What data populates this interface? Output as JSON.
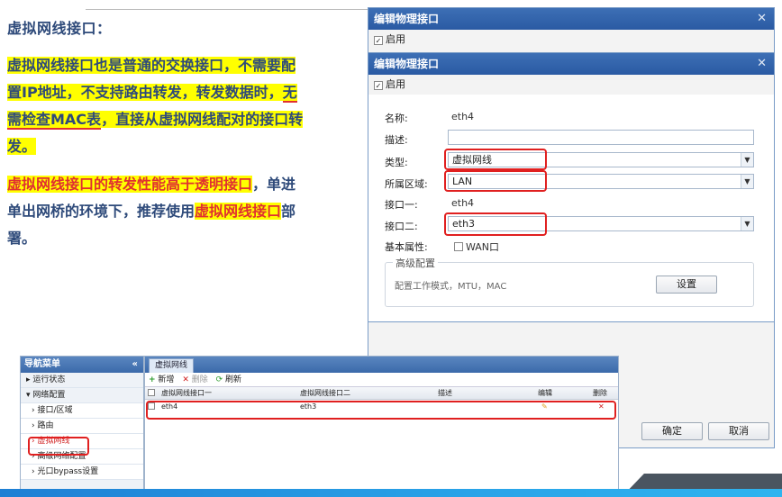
{
  "left_text": {
    "heading": "虚拟网线接口：",
    "p1_a": "虚拟网线接口",
    "p1_b": "也是普通的交换接口，不需要配置IP地址，不支持路由转发，转发数据时，",
    "p1_c": "无需检查MAC表",
    "p1_d": "，直接从虚拟网线配对的接口转发。",
    "p2_a": "虚拟网线接口的转发性能高于透明接口",
    "p2_b": "，单进单出网桥的环境下，推荐使用",
    "p2_c": "虚拟网线接口",
    "p2_d": "部署。"
  },
  "dialog_back": {
    "title": "编辑物理接口",
    "enable_label": "启用",
    "close": "✕"
  },
  "dialog_front": {
    "title": "编辑物理接口",
    "enable_label": "启用",
    "close": "✕",
    "name_label": "名称:",
    "name_value": "eth4",
    "desc_label": "描述:",
    "desc_value": "",
    "type_label": "类型:",
    "type_value": "虚拟网线",
    "zone_label": "所属区域:",
    "zone_value": "LAN",
    "if1_label": "接口一:",
    "if1_value": "eth4",
    "if2_label": "接口二:",
    "if2_value": "eth3",
    "basic_label": "基本属性:",
    "wan_label": "WAN口",
    "advanced_title": "高级配置",
    "advanced_desc": "配置工作模式，MTU，MAC",
    "settings_button": "设置",
    "ok_button": "确定",
    "cancel_button": "取消"
  },
  "nav": {
    "title": "导航菜单",
    "collapse": "«",
    "items": [
      {
        "label": "运行状态"
      },
      {
        "label": "网络配置"
      },
      {
        "label": "接口/区域"
      },
      {
        "label": "路由"
      },
      {
        "label": "虚拟网线"
      },
      {
        "label": "高级网络配置"
      },
      {
        "label": "光口bypass设置"
      }
    ]
  },
  "main": {
    "tab": "虚拟网线",
    "toolbar": {
      "add": "新增",
      "delete": "删除",
      "refresh": "刷新"
    },
    "columns": [
      "虚拟网线接口一",
      "虚拟网线接口二",
      "描述",
      "编辑",
      "删除"
    ],
    "rows": [
      {
        "if1": "eth4",
        "if2": "eth3",
        "desc": "",
        "edit": "✎",
        "delete": "✕"
      }
    ]
  },
  "colors": {
    "accent": "#2a5aa3",
    "highlight": "#ffff00",
    "text_blue": "#2e4a7a",
    "red": "#e03030"
  }
}
